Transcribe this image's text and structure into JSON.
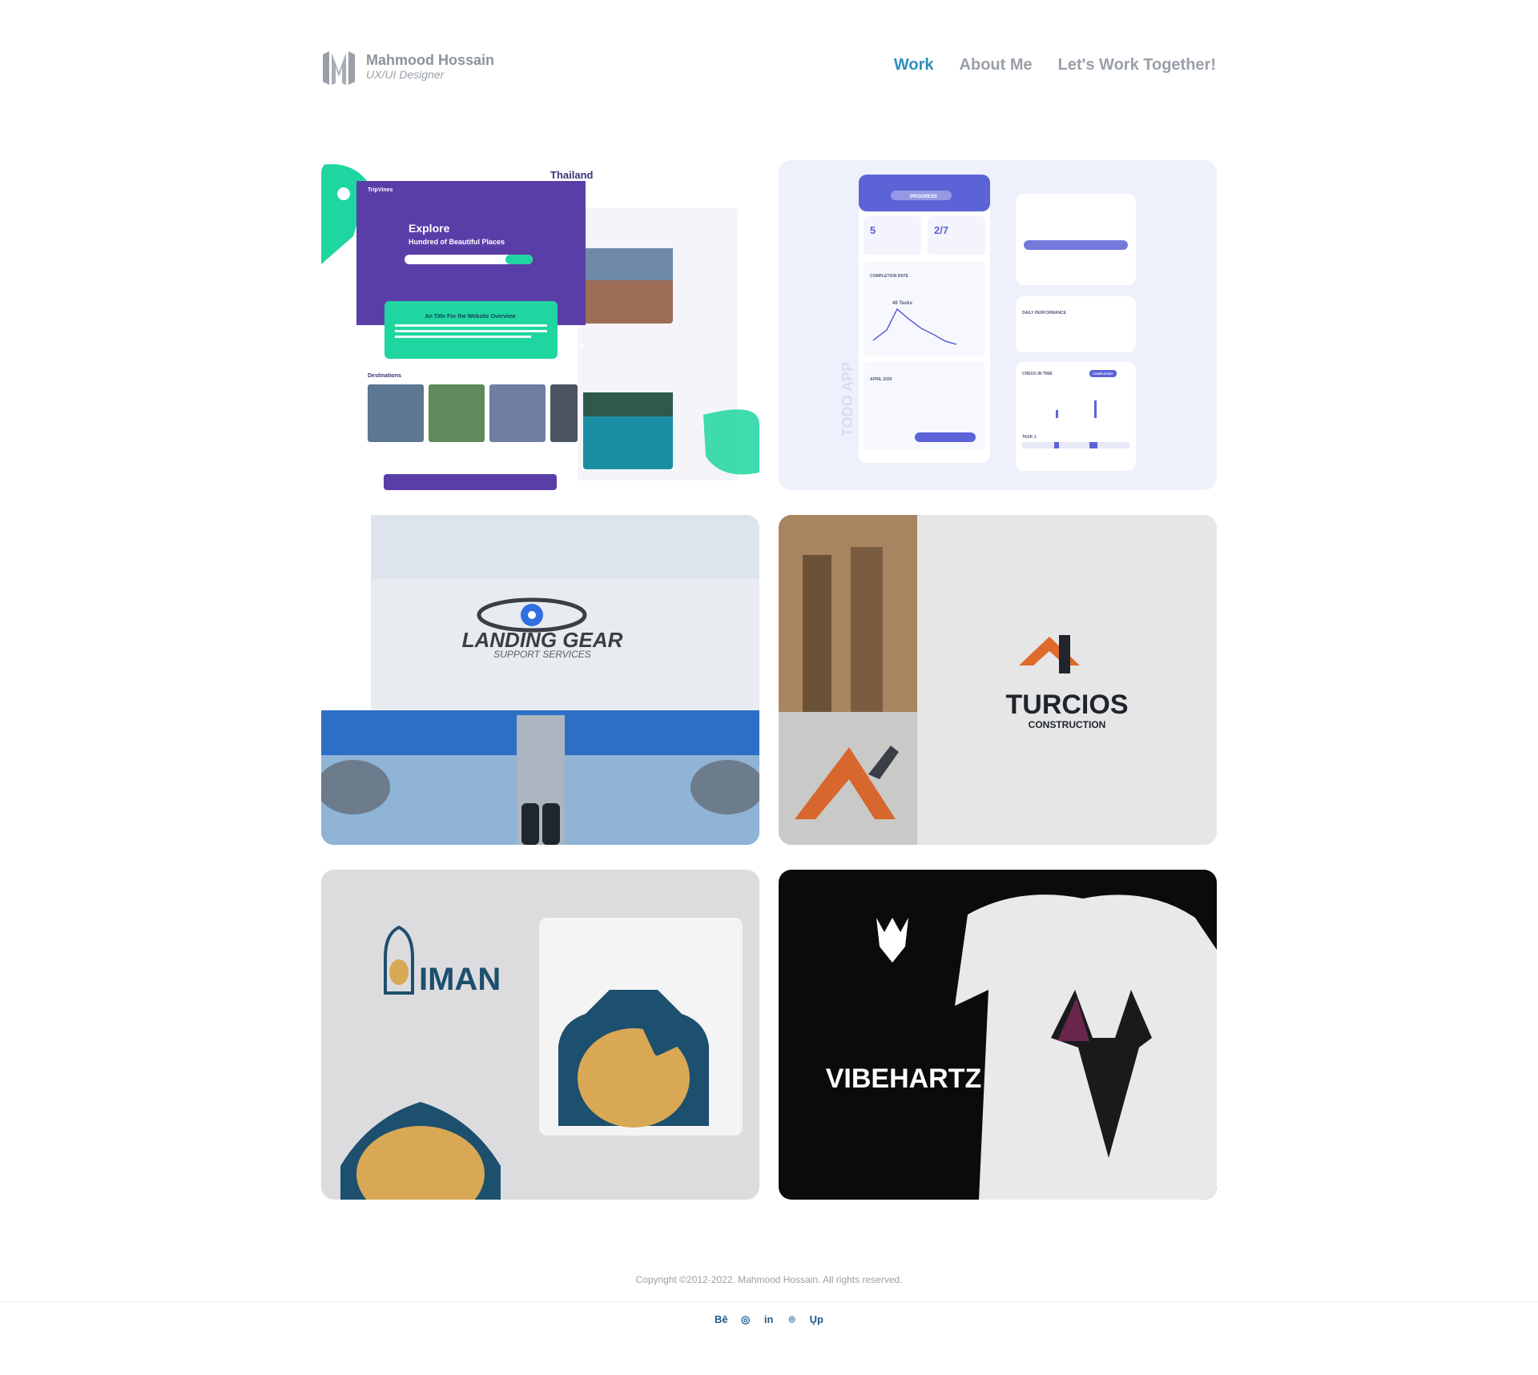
{
  "header": {
    "name": "Mahmood Hossain",
    "role": "UX/UI Designer",
    "nav": [
      "Work",
      "About Me",
      "Let's Work Together!"
    ]
  },
  "projects": {
    "trip": {
      "brand": "TripVines",
      "title": "Explore",
      "subtitle": "Hundred of Beautiful Places",
      "overview": "An Title For the Website Overview",
      "destinations": "Destinations",
      "country": "Thailand"
    },
    "todo": {
      "app_label": "TODO APP",
      "stat1": "5",
      "stat2": "2/7",
      "tab": "PROGRESS",
      "completion": "COMPLETION RATE",
      "tasks": "40 Tasks",
      "month": "APRIL 2020",
      "daily": "DAILY PERFORMANCE",
      "checkin": "CHECK-IN TIME",
      "completed": "COMPLETED",
      "task_label": "TASK-1"
    },
    "landing": {
      "title": "LANDING GEAR",
      "subtitle": "SUPPORT SERVICES"
    },
    "turcios": {
      "title": "TURCIOS",
      "subtitle": "CONSTRUCTION"
    },
    "iman": {
      "title": "IMAN"
    },
    "vibe": {
      "title": "VIBEHARTZ"
    }
  },
  "footer": {
    "copyright": "Copyright ©2012-2022. Mahmood Hossain. All rights reserved.",
    "social": [
      "Bē",
      "◎",
      "in",
      "⌾",
      "Ųp"
    ]
  },
  "colors": {
    "accent": "#2f8dbd",
    "nav_text": "#9aa0a8",
    "social": "#1f5b8c",
    "trip_purple": "#5a3ea8",
    "trip_teal": "#1fd6a0",
    "todo_blue": "#5c63d6"
  },
  "icons": [
    "logo-icon",
    "behance-icon",
    "dribbble-icon",
    "linkedin-icon",
    "instagram-icon",
    "upwork-icon"
  ]
}
